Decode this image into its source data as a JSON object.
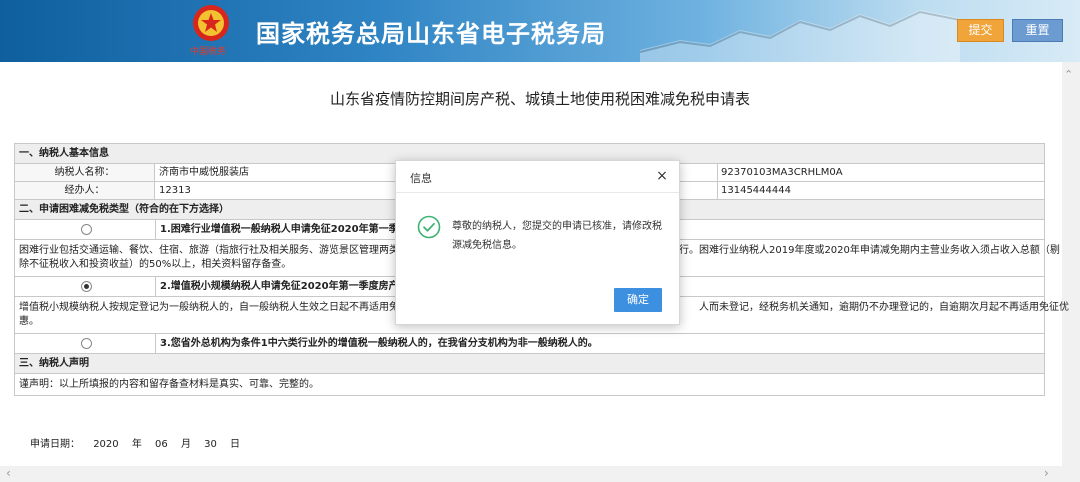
{
  "header": {
    "site_title": "国家税务总局山东省电子税务局",
    "emblem_caption": "中国税务",
    "submit_label": "提交",
    "reset_label": "重置"
  },
  "form": {
    "title": "山东省疫情防控期间房产税、城镇土地使用税困难减免税申请表",
    "section1_title": "一、纳税人基本信息",
    "taxpayer_name_label": "纳税人名称：",
    "taxpayer_name_value": "济南市中威悦服装店",
    "taxpayer_id_value": "92370103MA3CRHLM0A",
    "agent_label": "经办人：",
    "agent_value": "12313",
    "phone_value": "13145444444",
    "section2_title": "二、申请困难减免税类型（符合的在下方选择）",
    "options": [
      {
        "label": "1.困难行业增值税一般纳税人申请免征2020年第一季度",
        "selected": false,
        "description_left": "困难行业包括交通运输、餐饮、住宿、旅游（指旅行社及相关服务、游览景区管理两类）",
        "description_right": "行。困难行业纳税人2019年度或2020年申请减免期内主营业务收入须占收入总额（剔",
        "description_line2": "除不征税收入和投资收益）的50%以上，相关资料留存备查。"
      },
      {
        "label": "2.增值税小规模纳税人申请免征2020年第一季度房产税",
        "selected": true,
        "description_left": "增值税小规模纳税人按规定登记为一般纳税人的，自一般纳税人生效之日起不再适用免征优",
        "description_right": "人而未登记，经税务机关通知，逾期仍不办理登记的，自逾期次月起不再适用免征优",
        "description_line2": "惠。"
      },
      {
        "label": "3.您省外总机构为条件1中六类行业外的增值税一般纳税人的，在我省分支机构为非一般纳税人的。",
        "selected": false
      }
    ],
    "section3_title": "三、纳税人声明",
    "declaration": "谨声明：以上所填报的内容和留存备查材料是真实、可靠、完整的。",
    "apply_date_label": "申请日期：",
    "apply_year": "2020",
    "year_unit": "年",
    "apply_month": "06",
    "month_unit": "月",
    "apply_day": "30",
    "day_unit": "日"
  },
  "modal": {
    "title": "信息",
    "close_symbol": "×",
    "message": "尊敬的纳税人，您提交的申请已核准，请修改税源减免税信息。",
    "ok_label": "确定"
  },
  "colors": {
    "header_blue": "#0f5f9e",
    "submit_orange": "#f0a43a",
    "reset_blue": "#6b9bd0",
    "ok_blue": "#3d8fe0",
    "success_green": "#3cb371"
  },
  "icons": {
    "emblem": "national-tax-emblem-icon",
    "success": "check-circle-icon",
    "close": "close-icon"
  }
}
